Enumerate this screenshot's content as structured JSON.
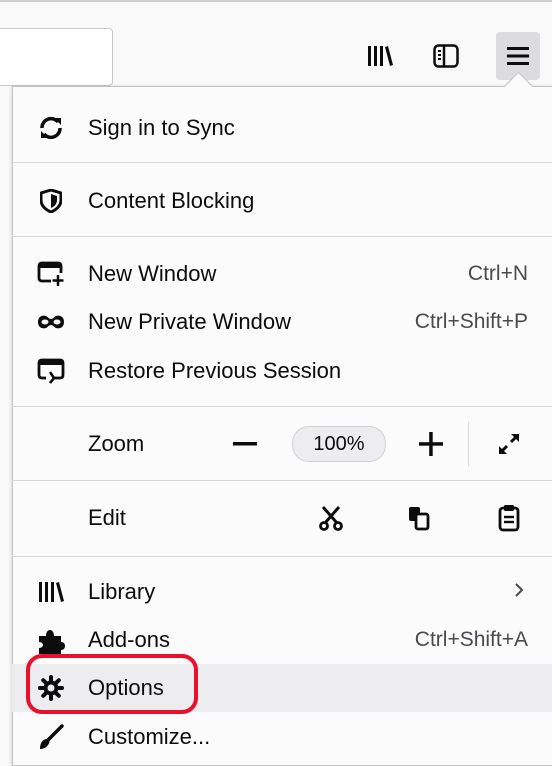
{
  "toolbar": {
    "library_icon": "library-icon",
    "sidebar_icon": "sidebar-icon",
    "menu_icon": "hamburger-menu-icon"
  },
  "menu": {
    "sync": {
      "label": "Sign in to Sync",
      "icon": "sync-icon"
    },
    "content_blocking": {
      "label": "Content Blocking",
      "icon": "shield-icon"
    },
    "new_window": {
      "label": "New Window",
      "shortcut": "Ctrl+N",
      "icon": "new-window-icon"
    },
    "new_private_window": {
      "label": "New Private Window",
      "shortcut": "Ctrl+Shift+P",
      "icon": "private-mask-icon"
    },
    "restore_session": {
      "label": "Restore Previous Session",
      "icon": "restore-session-icon"
    },
    "zoom": {
      "label": "Zoom",
      "value": "100%"
    },
    "edit": {
      "label": "Edit"
    },
    "library": {
      "label": "Library",
      "icon": "library-icon"
    },
    "addons": {
      "label": "Add-ons",
      "shortcut": "Ctrl+Shift+A",
      "icon": "puzzle-icon"
    },
    "options": {
      "label": "Options",
      "icon": "gear-icon"
    },
    "customize": {
      "label": "Customize...",
      "icon": "paintbrush-icon"
    }
  },
  "colors": {
    "highlight_ring": "#e8112d",
    "hover_row": "#ededf0"
  }
}
